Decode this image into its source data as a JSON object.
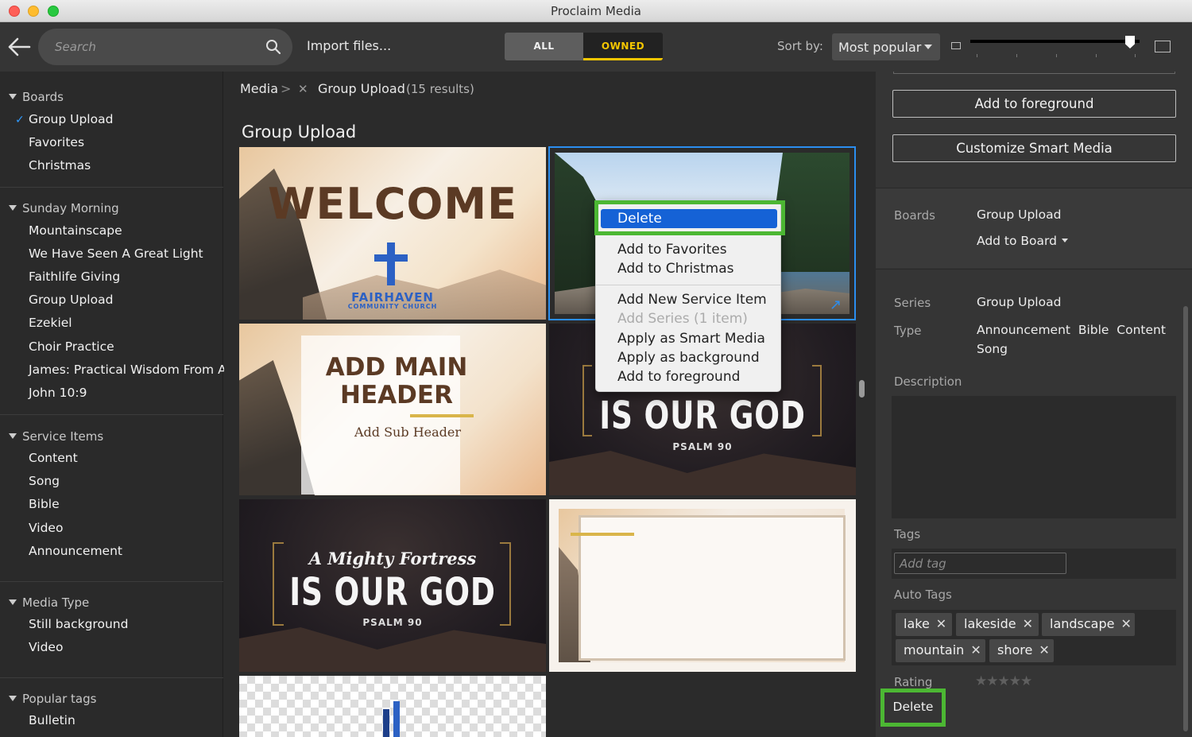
{
  "window": {
    "title": "Proclaim Media"
  },
  "toolbar": {
    "search_placeholder": "Search",
    "import_label": "Import files...",
    "filter_all": "ALL",
    "filter_owned": "OWNED",
    "sort_label": "Sort by:",
    "sort_value": "Most popular",
    "zoom_level": 0.97
  },
  "sidebar": {
    "boards": {
      "header": "Boards",
      "items": [
        "Group Upload",
        "Favorites",
        "Christmas"
      ],
      "checked_item": "Group Upload"
    },
    "sunday_morning": {
      "header": "Sunday Morning",
      "items": [
        "Mountainscape",
        "We Have Seen A Great Light",
        "Faithlife Giving",
        "Group Upload",
        "Ezekiel",
        "Choir Practice",
        "James: Practical Wisdom From Ab",
        "John 10:9"
      ]
    },
    "service_items": {
      "header": "Service Items",
      "items": [
        "Content",
        "Song",
        "Bible",
        "Video",
        "Announcement"
      ]
    },
    "media_type": {
      "header": "Media Type",
      "items": [
        "Still background",
        "Video"
      ]
    },
    "popular_tags": {
      "header": "Popular tags",
      "items": [
        "Bulletin"
      ]
    }
  },
  "main": {
    "breadcrumb_root": "Media",
    "breadcrumb_sep": ">",
    "breadcrumb_current": "Group Upload",
    "result_count": "(15 results)",
    "heading": "Group Upload",
    "tiles": {
      "welcome": {
        "title": "WELCOME",
        "church": "FAIRHAVEN",
        "church_sub": "COMMUNITY CHURCH"
      },
      "header": {
        "line1": "ADD MAIN",
        "line2": "HEADER",
        "sub": "Add Sub Header"
      },
      "god1": {
        "title": "IS OUR GOD",
        "ref": "PSALM 90"
      },
      "god2": {
        "script": "A Mighty Fortress",
        "title": "IS OUR GOD",
        "ref": "PSALM 90"
      }
    }
  },
  "context_menu": {
    "delete": "Delete",
    "add_favorites": "Add to Favorites",
    "add_christmas": "Add to Christmas",
    "add_service_item": "Add New Service Item",
    "add_series": "Add Series (1 item)",
    "apply_smart": "Apply as Smart Media",
    "apply_background": "Apply as background",
    "add_foreground": "Add to foreground"
  },
  "detail_panel": {
    "btn_foreground": "Add to foreground",
    "btn_customize": "Customize Smart Media",
    "boards_label": "Boards",
    "boards_value": "Group Upload",
    "add_to_board": "Add to Board",
    "series_label": "Series",
    "series_value": "Group Upload",
    "type_label": "Type",
    "type_value_1": "Announcement  Bible  Content",
    "type_value_2": "Song",
    "description_label": "Description",
    "tags_label": "Tags",
    "tag_placeholder": "Add tag",
    "auto_tags_label": "Auto Tags",
    "auto_tags": [
      "lake",
      "lakeside",
      "landscape",
      "mountain",
      "shore"
    ],
    "remove_glyph": "✕",
    "rating_label": "Rating",
    "rating_stars": "★★★★★",
    "rating_value": 0,
    "delete_label": "Delete"
  },
  "colors": {
    "accent_blue": "#2b8ef0",
    "owned_yellow": "#f4c600",
    "highlight_green": "#4cb733",
    "menu_selection": "#1562d6"
  }
}
